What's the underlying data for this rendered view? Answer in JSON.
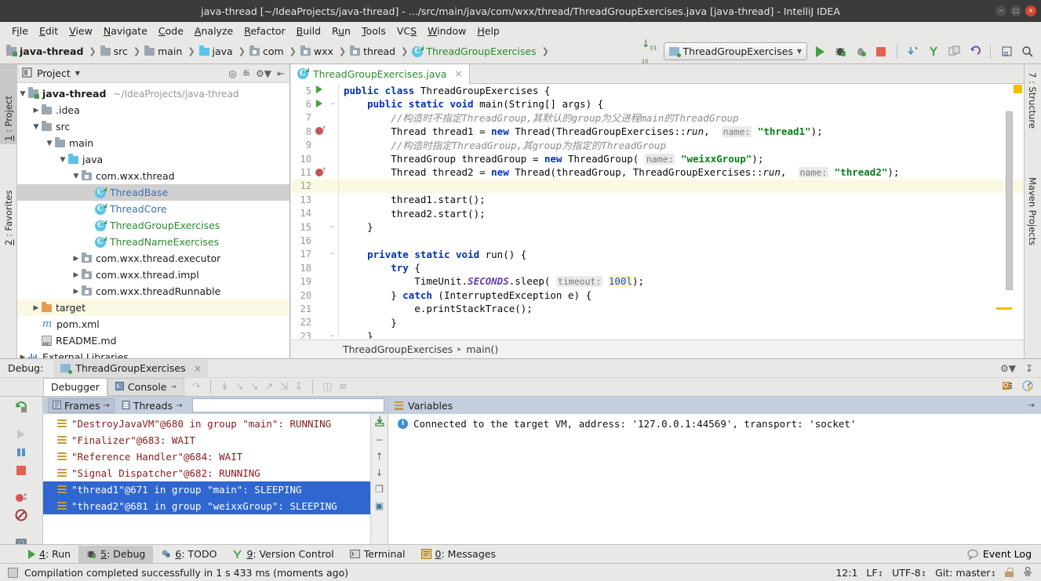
{
  "window": {
    "title": "java-thread [~/IdeaProjects/java-thread] - .../src/main/java/com/wxx/thread/ThreadGroupExercises.java [java-thread] - IntelliJ IDEA",
    "minimize": "−",
    "maximize": "□",
    "close": "×"
  },
  "menubar": {
    "items": [
      {
        "pre": "F",
        "mn": "i",
        "post": "le"
      },
      {
        "pre": "",
        "mn": "E",
        "post": "dit"
      },
      {
        "pre": "",
        "mn": "V",
        "post": "iew"
      },
      {
        "pre": "",
        "mn": "N",
        "post": "avigate"
      },
      {
        "pre": "",
        "mn": "C",
        "post": "ode"
      },
      {
        "pre": "",
        "mn": "A",
        "post": "nalyze"
      },
      {
        "pre": "",
        "mn": "R",
        "post": "efactor"
      },
      {
        "pre": "",
        "mn": "B",
        "post": "uild"
      },
      {
        "pre": "R",
        "mn": "u",
        "post": "n"
      },
      {
        "pre": "",
        "mn": "T",
        "post": "ools"
      },
      {
        "pre": "VC",
        "mn": "S",
        "post": ""
      },
      {
        "pre": "",
        "mn": "W",
        "post": "indow"
      },
      {
        "pre": "",
        "mn": "H",
        "post": "elp"
      }
    ]
  },
  "navbar": {
    "crumbs": [
      {
        "label": "java-thread",
        "icon": "module-icon",
        "style": "bold"
      },
      {
        "label": "src",
        "icon": "folder-icon",
        "style": "plain"
      },
      {
        "label": "main",
        "icon": "folder-icon",
        "style": "plain"
      },
      {
        "label": "java",
        "icon": "folder-source-icon",
        "style": "plain"
      },
      {
        "label": "com",
        "icon": "package-icon",
        "style": "plain"
      },
      {
        "label": "wxx",
        "icon": "package-icon",
        "style": "plain"
      },
      {
        "label": "thread",
        "icon": "package-icon",
        "style": "plain"
      },
      {
        "label": "ThreadGroupExercises",
        "icon": "java-class-icon",
        "style": "green"
      }
    ],
    "run_config": "ThreadGroupExercises",
    "icons": [
      "expand-collapse-icon",
      "run-icon",
      "debug-icon",
      "coverage-icon",
      "stop-icon",
      "update-project-icon",
      "commit-icon",
      "diff-icon",
      "undo-icon",
      "settings-icon",
      "search-everywhere-icon"
    ]
  },
  "left_strip": [
    {
      "num": "1",
      "label": ": Project",
      "active": true
    },
    {
      "num": "2",
      "label": ": Favorites",
      "active": false
    }
  ],
  "right_strip": [
    {
      "num": "7",
      "label": ": Structure"
    },
    {
      "num": "",
      "label": "Maven Projects"
    }
  ],
  "project_panel": {
    "title": "Project",
    "header_icons": [
      "target-icon",
      "collapse-all-icon",
      "gear-icon",
      "hide-icon"
    ],
    "tree": [
      {
        "depth": 0,
        "arrow": "▼",
        "icon": "module-icon",
        "label": "java-thread",
        "path": "~/IdeaProjects/java-thread",
        "bold": true,
        "state": "normal"
      },
      {
        "depth": 1,
        "arrow": "▶",
        "icon": "folder-icon",
        "label": ".idea",
        "path": "",
        "bold": false,
        "state": "normal"
      },
      {
        "depth": 1,
        "arrow": "▼",
        "icon": "folder-icon",
        "label": "src",
        "path": "",
        "bold": false,
        "state": "normal"
      },
      {
        "depth": 2,
        "arrow": "▼",
        "icon": "folder-icon",
        "label": "main",
        "path": "",
        "bold": false,
        "state": "normal"
      },
      {
        "depth": 3,
        "arrow": "▼",
        "icon": "folder-source-icon",
        "label": "java",
        "path": "",
        "bold": false,
        "state": "normal"
      },
      {
        "depth": 4,
        "arrow": "▼",
        "icon": "package-icon",
        "label": "com.wxx.thread",
        "path": "",
        "bold": false,
        "state": "normal"
      },
      {
        "depth": 5,
        "arrow": "",
        "icon": "java-class-icon",
        "label": "ThreadBase",
        "path": "",
        "bold": false,
        "state": "selected",
        "cls": "blue"
      },
      {
        "depth": 5,
        "arrow": "",
        "icon": "java-class-icon",
        "label": "ThreadCore",
        "path": "",
        "bold": false,
        "state": "normal",
        "cls": "blue"
      },
      {
        "depth": 5,
        "arrow": "",
        "icon": "java-class-icon",
        "label": "ThreadGroupExercises",
        "path": "",
        "bold": false,
        "state": "normal",
        "cls": "green"
      },
      {
        "depth": 5,
        "arrow": "",
        "icon": "java-class-icon",
        "label": "ThreadNameExercises",
        "path": "",
        "bold": false,
        "state": "normal",
        "cls": "green"
      },
      {
        "depth": 4,
        "arrow": "▶",
        "icon": "package-icon",
        "label": "com.wxx.thread.executor",
        "path": "",
        "bold": false,
        "state": "normal"
      },
      {
        "depth": 4,
        "arrow": "▶",
        "icon": "package-icon",
        "label": "com.wxx.thread.impl",
        "path": "",
        "bold": false,
        "state": "normal"
      },
      {
        "depth": 4,
        "arrow": "▶",
        "icon": "package-icon",
        "label": "com.wxx.threadRunnable",
        "path": "",
        "bold": false,
        "state": "normal"
      },
      {
        "depth": 1,
        "arrow": "▶",
        "icon": "folder-target-icon",
        "label": "target",
        "path": "",
        "bold": false,
        "state": "highlight"
      },
      {
        "depth": 1,
        "arrow": "",
        "icon": "maven-xml-icon",
        "label": "pom.xml",
        "path": "",
        "bold": false,
        "state": "normal"
      },
      {
        "depth": 1,
        "arrow": "",
        "icon": "markdown-icon",
        "label": "README.md",
        "path": "",
        "bold": false,
        "state": "normal"
      },
      {
        "depth": 0,
        "arrow": "▶",
        "icon": "libraries-icon",
        "label": "External Libraries",
        "path": "",
        "bold": false,
        "state": "normal"
      }
    ]
  },
  "editor": {
    "tab": {
      "label": "ThreadGroupExercises.java",
      "close": "×",
      "icon": "java-class-icon"
    },
    "breadcrumb": [
      "ThreadGroupExercises",
      "main()"
    ],
    "lines": [
      {
        "num": "5",
        "mark": "run",
        "fold": "",
        "current": false,
        "tokens": [
          {
            "t": "kw",
            "v": "public class "
          },
          {
            "t": "p",
            "v": "ThreadGroupExercises {"
          }
        ]
      },
      {
        "num": "6",
        "mark": "run",
        "fold": "−",
        "current": false,
        "tokens": [
          {
            "t": "p",
            "v": "    "
          },
          {
            "t": "kw",
            "v": "public static void "
          },
          {
            "t": "p",
            "v": "main(String[] args) {"
          }
        ]
      },
      {
        "num": "7",
        "mark": "",
        "fold": "",
        "current": false,
        "tokens": [
          {
            "t": "cmt",
            "v": "        //构造时不指定ThreadGroup,其默认的group为父进程main的ThreadGroup"
          }
        ]
      },
      {
        "num": "8",
        "mark": "bp",
        "fold": "",
        "current": false,
        "tokens": [
          {
            "t": "p",
            "v": "        Thread thread1 = "
          },
          {
            "t": "kw",
            "v": "new "
          },
          {
            "t": "p",
            "v": "Thread(ThreadGroupExercises::"
          },
          {
            "t": "ital",
            "v": "run"
          },
          {
            "t": "p",
            "v": ",  "
          },
          {
            "t": "hint",
            "v": "name:"
          },
          {
            "t": "p",
            "v": " "
          },
          {
            "t": "str",
            "v": "\"thread1\""
          },
          {
            "t": "p",
            "v": ");"
          }
        ]
      },
      {
        "num": "9",
        "mark": "",
        "fold": "",
        "current": false,
        "tokens": [
          {
            "t": "cmt",
            "v": "        //构造时指定ThreadGroup,其group为指定的ThreadGroup"
          }
        ]
      },
      {
        "num": "10",
        "mark": "",
        "fold": "",
        "current": false,
        "tokens": [
          {
            "t": "p",
            "v": "        ThreadGroup threadGroup = "
          },
          {
            "t": "kw",
            "v": "new "
          },
          {
            "t": "p",
            "v": "ThreadGroup( "
          },
          {
            "t": "hint",
            "v": "name:"
          },
          {
            "t": "p",
            "v": " "
          },
          {
            "t": "str",
            "v": "\"weixxGroup\""
          },
          {
            "t": "p",
            "v": ");"
          }
        ]
      },
      {
        "num": "11",
        "mark": "bp",
        "fold": "",
        "current": false,
        "tokens": [
          {
            "t": "p",
            "v": "        Thread thread2 = "
          },
          {
            "t": "kw",
            "v": "new "
          },
          {
            "t": "p",
            "v": "Thread(threadGroup, ThreadGroupExercises::"
          },
          {
            "t": "ital",
            "v": "run"
          },
          {
            "t": "p",
            "v": ",  "
          },
          {
            "t": "hint",
            "v": "name:"
          },
          {
            "t": "p",
            "v": " "
          },
          {
            "t": "str",
            "v": "\"thread2\""
          },
          {
            "t": "p",
            "v": ");"
          }
        ]
      },
      {
        "num": "12",
        "mark": "",
        "fold": "",
        "current": true,
        "tokens": [
          {
            "t": "p",
            "v": ""
          }
        ]
      },
      {
        "num": "13",
        "mark": "",
        "fold": "",
        "current": false,
        "tokens": [
          {
            "t": "p",
            "v": "        thread1.start();"
          }
        ]
      },
      {
        "num": "14",
        "mark": "",
        "fold": "",
        "current": false,
        "tokens": [
          {
            "t": "p",
            "v": "        thread2.start();"
          }
        ]
      },
      {
        "num": "15",
        "mark": "",
        "fold": "−",
        "current": false,
        "tokens": [
          {
            "t": "p",
            "v": "    }"
          }
        ]
      },
      {
        "num": "16",
        "mark": "",
        "fold": "",
        "current": false,
        "tokens": [
          {
            "t": "p",
            "v": ""
          }
        ]
      },
      {
        "num": "17",
        "mark": "",
        "fold": "−",
        "current": false,
        "tokens": [
          {
            "t": "p",
            "v": "    "
          },
          {
            "t": "kw",
            "v": "private static void "
          },
          {
            "t": "p",
            "v": "run() {"
          }
        ]
      },
      {
        "num": "18",
        "mark": "",
        "fold": "",
        "current": false,
        "tokens": [
          {
            "t": "p",
            "v": "        "
          },
          {
            "t": "kw",
            "v": "try "
          },
          {
            "t": "p",
            "v": "{"
          }
        ]
      },
      {
        "num": "19",
        "mark": "",
        "fold": "",
        "current": false,
        "tokens": [
          {
            "t": "p",
            "v": "            TimeUnit."
          },
          {
            "t": "stat",
            "v": "SECONDS"
          },
          {
            "t": "p",
            "v": ".sleep( "
          },
          {
            "t": "hint",
            "v": "timeout:"
          },
          {
            "t": "p",
            "v": " "
          },
          {
            "t": "num",
            "v": "100l"
          },
          {
            "t": "p",
            "v": ");"
          }
        ]
      },
      {
        "num": "20",
        "mark": "",
        "fold": "",
        "current": false,
        "tokens": [
          {
            "t": "p",
            "v": "        } "
          },
          {
            "t": "kw",
            "v": "catch "
          },
          {
            "t": "p",
            "v": "(InterruptedException e) {"
          }
        ]
      },
      {
        "num": "21",
        "mark": "",
        "fold": "",
        "current": false,
        "tokens": [
          {
            "t": "p",
            "v": "            e.printStackTrace();"
          }
        ]
      },
      {
        "num": "22",
        "mark": "",
        "fold": "",
        "current": false,
        "tokens": [
          {
            "t": "p",
            "v": "        }"
          }
        ]
      },
      {
        "num": "23",
        "mark": "",
        "fold": "−",
        "current": false,
        "tokens": [
          {
            "t": "p",
            "v": "    }"
          }
        ]
      }
    ]
  },
  "debug": {
    "label": "Debug:",
    "session": "ThreadGroupExercises",
    "session_close": "×",
    "tabs": [
      {
        "label": "Debugger",
        "active": true,
        "icon": ""
      },
      {
        "label": "Console",
        "active": false,
        "icon": "console-icon",
        "arrow": "→"
      }
    ],
    "step_icons": [
      "show-execution-point-icon",
      "step-over-icon",
      "step-into-icon",
      "force-step-into-icon",
      "step-out-icon",
      "drop-frame-icon",
      "run-to-cursor-icon",
      "evaluate-icon",
      "mute-breakpoints-icon"
    ],
    "left_tools": [
      "rerun-icon",
      "resume-icon",
      "pause-icon",
      "stop-icon",
      "view-breakpoints-icon",
      "mute-breakpoints-icon",
      "settings-camera-icon",
      "more-icon"
    ],
    "frames": {
      "frames_label": "Frames",
      "threads_label": "Threads",
      "arrow": "→",
      "rows": [
        {
          "text": "\"DestroyJavaVM\"@680 in group \"main\": RUNNING",
          "selected": false
        },
        {
          "text": "\"Finalizer\"@683: WAIT",
          "selected": false
        },
        {
          "text": "\"Reference Handler\"@684: WAIT",
          "selected": false
        },
        {
          "text": "\"Signal Dispatcher\"@682: RUNNING",
          "selected": false
        },
        {
          "text": "\"thread1\"@671 in group \"main\": SLEEPING",
          "selected": true
        },
        {
          "text": "\"thread2\"@681 in group \"weixxGroup\": SLEEPING",
          "selected": true
        }
      ],
      "side_icons": [
        "export-threads-icon",
        "minus-icon",
        "up-arrow-icon",
        "down-arrow-icon",
        "copy-icon",
        "customize-icon"
      ]
    },
    "variables": {
      "title": "Variables",
      "arrow": "→",
      "message": "Connected to the target VM, address: '127.0.0.1:44569', transport: 'socket'"
    }
  },
  "toolwindow_bar": {
    "items": [
      {
        "num": "4",
        "label": ": Run",
        "icon": "run-icon",
        "active": false
      },
      {
        "num": "5",
        "label": ": Debug",
        "icon": "debug-icon",
        "active": true
      },
      {
        "num": "6",
        "label": ": TODO",
        "icon": "todo-icon",
        "active": false
      },
      {
        "num": "9",
        "label": ": Version Control",
        "icon": "vcs-icon",
        "active": false
      },
      {
        "num": "",
        "label": "Terminal",
        "icon": "terminal-icon",
        "active": false
      },
      {
        "num": "0",
        "label": ": Messages",
        "icon": "messages-icon",
        "active": false
      }
    ],
    "event_log": "Event Log",
    "event_log_icon": "search-bubble-icon"
  },
  "statusbar": {
    "message": "Compilation completed successfully in 1 s 433 ms (moments ago)",
    "caret": "12:1",
    "line_sep": "LF",
    "encoding": "UTF-8",
    "vcs": "Git: master",
    "lock_icon": "read-only-lock-icon",
    "inspect_icon": "inspection-icon"
  },
  "colors": {
    "accent_green": "#3fa13f",
    "selection_blue": "#2f66d0",
    "titlebar": "#3b3b3b",
    "panel_bg": "#e8e8e7",
    "keyword": "#0033b3",
    "string": "#067d17",
    "comment": "#8c8c8c"
  }
}
